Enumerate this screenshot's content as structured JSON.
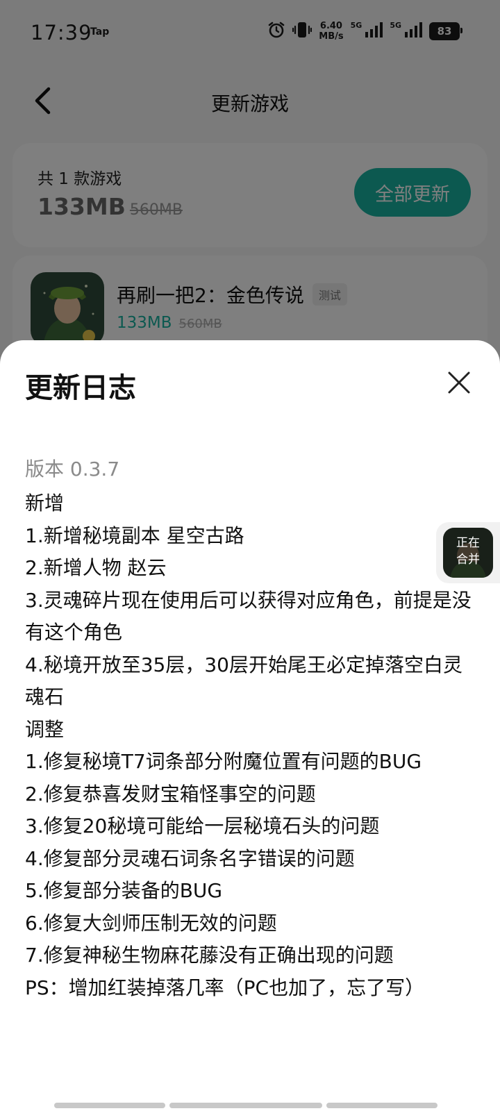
{
  "status_bar": {
    "time": "17:39",
    "tap_label": "Tap",
    "speed_value": "6.40",
    "speed_unit": "MB/s",
    "net1": "5G",
    "net2": "5G",
    "battery": "83"
  },
  "nav": {
    "title": "更新游戏"
  },
  "summary": {
    "count": "共 1 款游戏",
    "size": "133MB",
    "size_old": "560MB",
    "update_all": "全部更新"
  },
  "game": {
    "name": "再刷一把2：金色传说",
    "tag": "测试",
    "size": "133MB",
    "size_old": "560MB"
  },
  "sheet": {
    "title": "更新日志",
    "version": "版本 0.3.7",
    "lines": [
      "新增",
      "1.新增秘境副本 星空古路",
      "2.新增人物 赵云",
      "3.灵魂碎片现在使用后可以获得对应角色，前提是没有这个角色",
      "4.秘境开放至35层，30层开始尾王必定掉落空白灵魂石",
      "调整",
      "1.修复秘境T7词条部分附魔位置有问题的BUG",
      "2.修复恭喜发财宝箱怪事空的问题",
      "3.修复20秘境可能给一层秘境石头的问题",
      "4.修复部分灵魂石词条名字错误的问题",
      "5.修复部分装备的BUG",
      "6.修复大剑师压制无效的问题",
      "7.修复神秘生物麻花藤没有正确出现的问题",
      "PS：增加红装掉落几率（PC也加了，忘了写）"
    ]
  },
  "float": {
    "line1": "正在",
    "line2": "合并"
  },
  "colors": {
    "accent": "#19b3a1"
  }
}
